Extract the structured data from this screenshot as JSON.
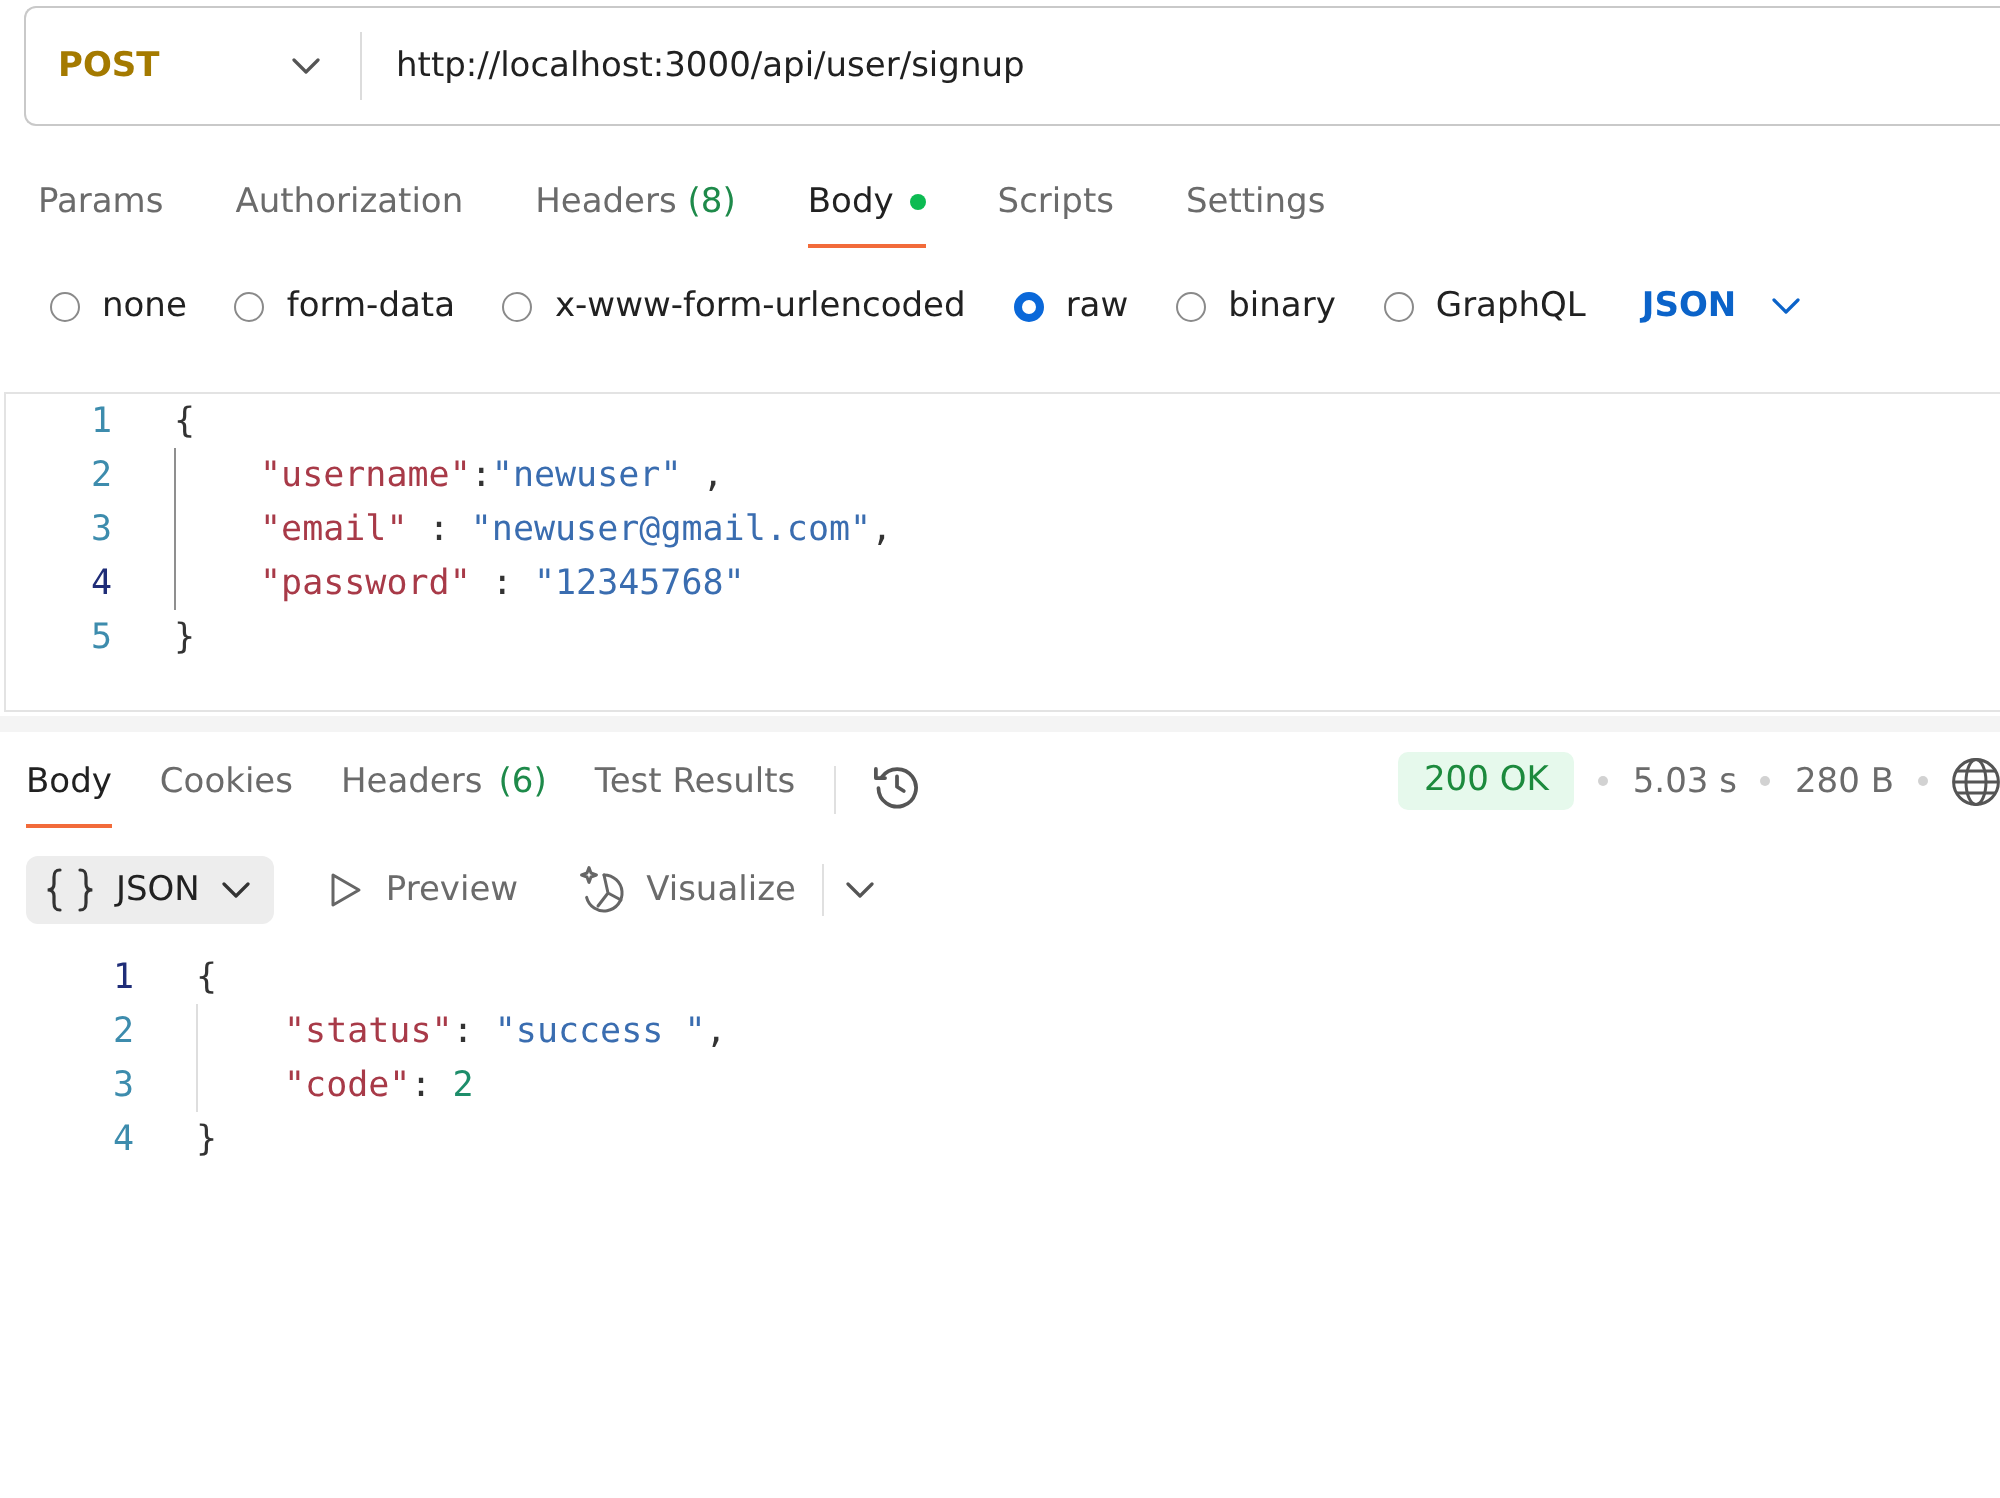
{
  "request": {
    "method": "POST",
    "url": "http://localhost:3000/api/user/signup"
  },
  "request_tabs": [
    {
      "label": "Params",
      "selected": false,
      "dot": false
    },
    {
      "label": "Authorization",
      "selected": false,
      "dot": false
    },
    {
      "label": "Headers",
      "count": "(8)",
      "selected": false,
      "dot": false
    },
    {
      "label": "Body",
      "selected": true,
      "dot": true
    },
    {
      "label": "Scripts",
      "selected": false,
      "dot": false
    },
    {
      "label": "Settings",
      "selected": false,
      "dot": false
    }
  ],
  "body_types": [
    {
      "label": "none",
      "selected": false
    },
    {
      "label": "form-data",
      "selected": false
    },
    {
      "label": "x-www-form-urlencoded",
      "selected": false
    },
    {
      "label": "raw",
      "selected": true
    },
    {
      "label": "binary",
      "selected": false
    },
    {
      "label": "GraphQL",
      "selected": false
    }
  ],
  "raw_format": "JSON",
  "request_body": {
    "lines": [
      {
        "number": "1",
        "active": false,
        "tokens": [
          {
            "kind": "punct",
            "text": "{"
          }
        ],
        "children": [
          {
            "number": "2",
            "active": false,
            "tokens": [
              {
                "kind": "key",
                "text": "\"username\""
              },
              {
                "kind": "punct",
                "text": ":"
              },
              {
                "kind": "string",
                "text": "\"newuser\""
              },
              {
                "kind": "punct",
                "text": " ,"
              }
            ]
          },
          {
            "number": "3",
            "active": false,
            "tokens": [
              {
                "kind": "key",
                "text": "\"email\""
              },
              {
                "kind": "punct",
                "text": " : "
              },
              {
                "kind": "string",
                "text": "\"newuser@gmail.com\""
              },
              {
                "kind": "punct",
                "text": ","
              }
            ]
          },
          {
            "number": "4",
            "active": true,
            "tokens": [
              {
                "kind": "key",
                "text": "\"password\""
              },
              {
                "kind": "punct",
                "text": " : "
              },
              {
                "kind": "string",
                "text": "\"12345768\""
              }
            ]
          }
        ]
      },
      {
        "number": "5",
        "active": false,
        "tokens": [
          {
            "kind": "punct",
            "text": "}"
          }
        ]
      }
    ]
  },
  "response_tabs": [
    {
      "label": "Body",
      "selected": true
    },
    {
      "label": "Cookies",
      "selected": false
    },
    {
      "label": "Headers",
      "count": "(6)",
      "selected": false
    },
    {
      "label": "Test Results",
      "selected": false
    }
  ],
  "response_status": {
    "status": "200 OK",
    "time": "5.03 s",
    "size": "280 B"
  },
  "response_toolbar": {
    "format": "JSON",
    "preview": "Preview",
    "visualize": "Visualize"
  },
  "response_body": {
    "lines": [
      {
        "number": "1",
        "active": true,
        "tokens": [
          {
            "kind": "punct",
            "text": "{"
          }
        ],
        "children": [
          {
            "number": "2",
            "active": false,
            "tokens": [
              {
                "kind": "key",
                "text": "\"status\""
              },
              {
                "kind": "punct",
                "text": ": "
              },
              {
                "kind": "string",
                "text": "\"success \""
              },
              {
                "kind": "punct",
                "text": ","
              }
            ]
          },
          {
            "number": "3",
            "active": false,
            "tokens": [
              {
                "kind": "key",
                "text": "\"code\""
              },
              {
                "kind": "punct",
                "text": ": "
              },
              {
                "kind": "number",
                "text": "2"
              }
            ]
          }
        ]
      },
      {
        "number": "4",
        "active": false,
        "tokens": [
          {
            "kind": "punct",
            "text": "}"
          }
        ]
      }
    ]
  }
}
